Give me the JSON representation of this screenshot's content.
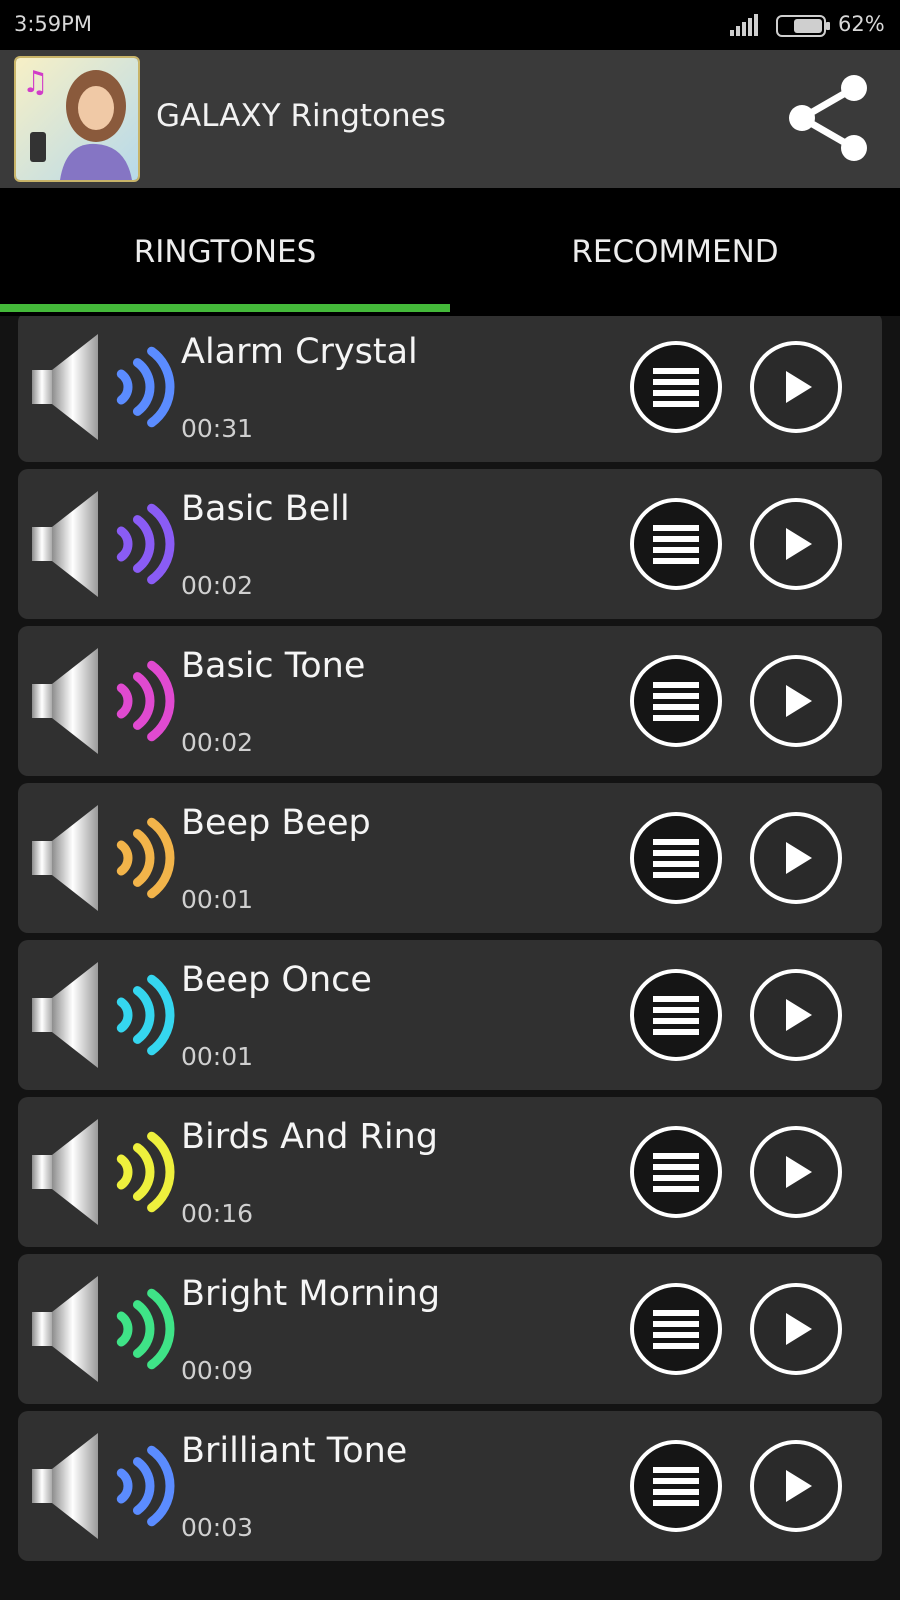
{
  "status_bar": {
    "time": "3:59PM",
    "battery": "62%",
    "signal_icon": "signal-bars-icon",
    "battery_icon": "battery-icon"
  },
  "app_bar": {
    "title": "GALAXY Ringtones",
    "logo_icon": "app-logo-icon",
    "share_icon": "share-icon"
  },
  "tabs": [
    {
      "label": "RINGTONES",
      "active": true
    },
    {
      "label": "RECOMMEND",
      "active": false
    }
  ],
  "colors": {
    "tab_indicator": "#44b93a",
    "row_background": "#303030",
    "background": "#131313"
  },
  "ringtones": [
    {
      "title": "Alarm Crystal",
      "duration": "00:31",
      "wave_color": "#5b8cff"
    },
    {
      "title": "Basic Bell",
      "duration": "00:02",
      "wave_color": "#8a5cf5"
    },
    {
      "title": "Basic Tone",
      "duration": "00:02",
      "wave_color": "#e04ad0"
    },
    {
      "title": "Beep Beep",
      "duration": "00:01",
      "wave_color": "#f2b44a"
    },
    {
      "title": "Beep Once",
      "duration": "00:01",
      "wave_color": "#35d6ef"
    },
    {
      "title": "Birds And Ring",
      "duration": "00:16",
      "wave_color": "#eef03d"
    },
    {
      "title": "Bright Morning",
      "duration": "00:09",
      "wave_color": "#3fe387"
    },
    {
      "title": "Brilliant Tone",
      "duration": "00:03",
      "wave_color": "#5b8cff"
    }
  ],
  "row_icons": {
    "speaker": "speaker-icon",
    "menu": "menu-icon",
    "play": "play-icon"
  }
}
